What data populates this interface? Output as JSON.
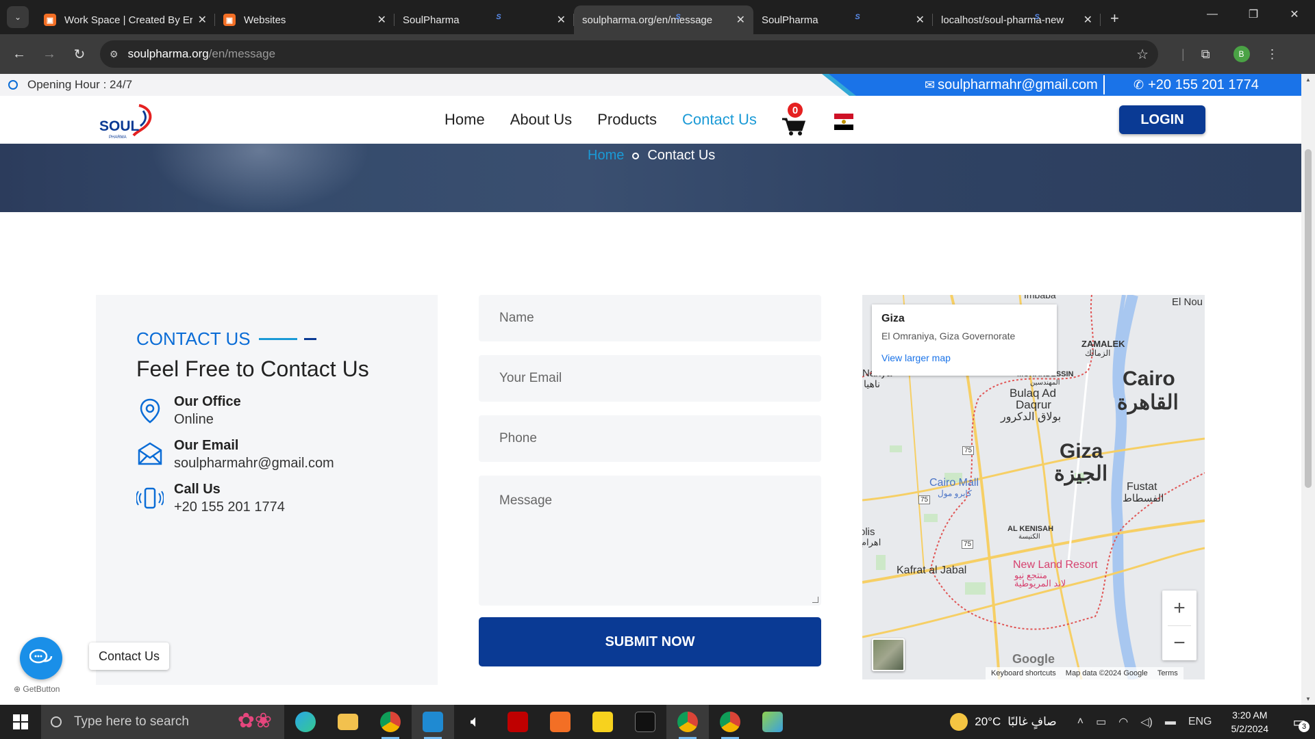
{
  "browser": {
    "tabs": [
      {
        "title": "Work Space | Created By Er",
        "icon": "orange-app-icon",
        "active": false
      },
      {
        "title": "Websites",
        "icon": "orange-app-icon",
        "active": false
      },
      {
        "title": "SoulPharma",
        "icon": "soulpharma-favicon",
        "active": false
      },
      {
        "title": "soulpharma.org/en/message",
        "icon": "soulpharma-favicon",
        "active": true
      },
      {
        "title": "SoulPharma",
        "icon": "soulpharma-favicon",
        "active": false
      },
      {
        "title": "localhost/soul-pharma-new",
        "icon": "soulpharma-favicon",
        "active": false
      }
    ],
    "url_domain": "soulpharma.org",
    "url_path": "/en/message",
    "profile_initial": "B"
  },
  "topbar": {
    "opening_hours": "Opening Hour : 24/7",
    "email": "soulpharmahr@gmail.com",
    "phone": "+20 155 201 1774"
  },
  "header": {
    "logo_text": "SOUL",
    "logo_sub": "PHARMA",
    "nav": [
      {
        "label": "Home",
        "active": false
      },
      {
        "label": "About Us",
        "active": false
      },
      {
        "label": "Products",
        "active": false
      },
      {
        "label": "Contact Us",
        "active": true
      }
    ],
    "cart_count": "0",
    "login_label": "LOGIN"
  },
  "breadcrumb": {
    "home": "Home",
    "current": "Contact Us"
  },
  "contact_info": {
    "subtitle": "CONTACT US",
    "title": "Feel Free to Contact Us",
    "items": [
      {
        "label": "Our Office",
        "value": "Online",
        "icon": "location-pin-icon"
      },
      {
        "label": "Our Email",
        "value": "soulpharmahr@gmail.com",
        "icon": "envelope-icon"
      },
      {
        "label": "Call Us",
        "value": "+20 155 201 1774",
        "icon": "phone-vibrate-icon"
      }
    ]
  },
  "form": {
    "name_placeholder": "Name",
    "email_placeholder": "Your Email",
    "phone_placeholder": "Phone",
    "message_placeholder": "Message",
    "submit_label": "SUBMIT NOW"
  },
  "map": {
    "place": "Giza",
    "address": "El Omraniya, Giza Governorate",
    "larger_map": "View larger map",
    "labels": {
      "cairo_en": "Cairo",
      "cairo_ar": "القاهرة",
      "giza_en": "Giza",
      "giza_ar": "الجيزة",
      "zamalek": "ZAMALEK",
      "zamalek_ar": "الزمالك",
      "mohandessin": "MOHANDESSIN",
      "mohandessin_ar": "المهندسين",
      "bulaq_1": "Bulaq Ad",
      "bulaq_2": "Daqrur",
      "bulaq_ar": "بولاق الدكرور",
      "nahya": "Nahya",
      "nahya_ar": "ناهيا",
      "imbaba": "Imbaba",
      "el_nou": "El Nou",
      "cairo_mall": "Cairo Mall",
      "cairo_mall_ar": "كايرو مول",
      "fustat": "Fustat",
      "fustat_ar": "الفسطاط",
      "al_kenisah": "AL KENISAH",
      "al_kenisah_ar": "الكنيسة",
      "kafrat": "Kafrat al Jabal",
      "new_land": "New Land Resort",
      "new_land_ar_1": "منتجع نيو",
      "new_land_ar_2": "لاند المريوطية",
      "road_75": "75",
      "olis": "olis",
      "olis_ar": "اهرام"
    },
    "google": "Google",
    "footer": [
      "Keyboard shortcuts",
      "Map data ©2024 Google",
      "Terms"
    ]
  },
  "float": {
    "tooltip": "Contact Us",
    "brand": "GetButton"
  },
  "taskbar": {
    "search_placeholder": "Type here to search",
    "weather_temp": "20°C",
    "weather_desc": "صافٍ غالبًا",
    "lang": "ENG",
    "time": "3:20 AM",
    "date": "5/2/2024",
    "notification_count": "3"
  },
  "colors": {
    "brand_blue": "#0a3a94",
    "accent_cyan": "#1a9ad6",
    "topbar_blue": "#1a73e8"
  }
}
